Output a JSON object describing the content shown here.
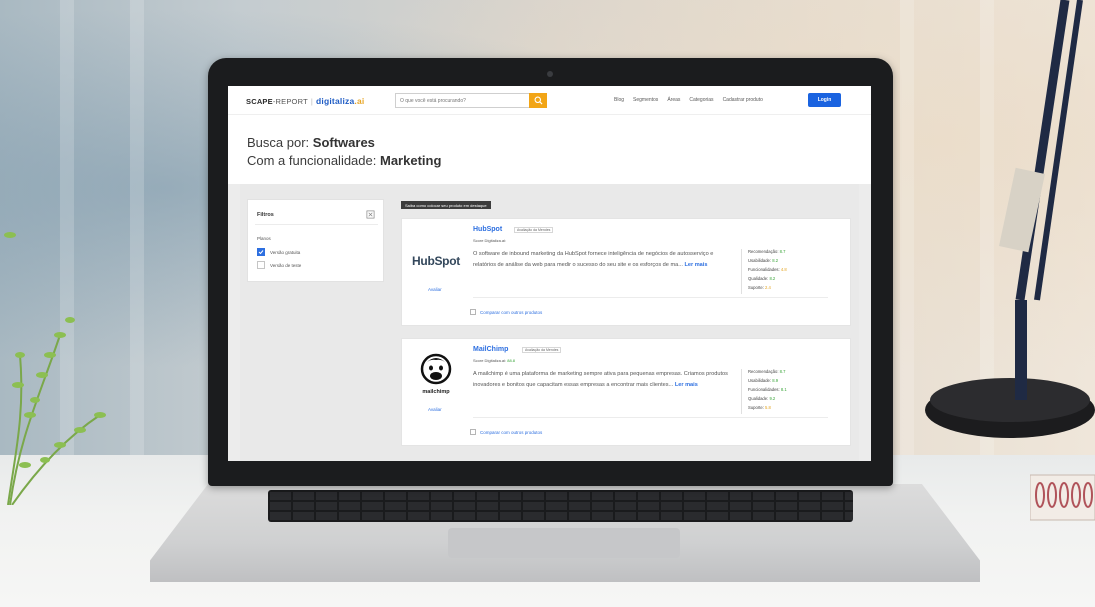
{
  "site": {
    "logo_part1": "SCAPE",
    "logo_part2": "-REPORT",
    "logo_brand": "digitaliza",
    "logo_brand_tld": ".ai"
  },
  "search": {
    "placeholder": "O que você está procurando?"
  },
  "nav": {
    "items": [
      "Blog",
      "Segmentos",
      "Áreas",
      "Categorias",
      "Cadastrar produto"
    ],
    "login_label": "Login"
  },
  "header": {
    "line1_prefix": "Busca por:",
    "line1_value": "Softwares",
    "line2_prefix": "Com a funcionalidade:",
    "line2_value": "Marketing"
  },
  "filters": {
    "title": "Filtros",
    "group_label": "Planos",
    "options": [
      {
        "label": "Versão gratuita",
        "checked": true
      },
      {
        "label": "Versão de teste",
        "checked": false
      }
    ]
  },
  "featured_tag": "Saiba como colocar seu produto em destaque",
  "products": [
    {
      "name": "HubSpot",
      "badge": "Avaliação da Mendes",
      "score_label": "Score Digitaliza.ai:",
      "score_value": "",
      "description": "O software de inbound marketing da HubSpot fornece inteligência de negócios de autosserviço e relatórios de análise da web para medir o sucesso do seu site e os esforços de ma...",
      "read_more": "Ler mais",
      "evaluate": "Avaliar",
      "compare": "Comparar com outros produtos",
      "logo_text": "HubSpot",
      "metrics": [
        {
          "label": "Recomendação:",
          "value": "8.7",
          "color": "green"
        },
        {
          "label": "Usabilidade:",
          "value": "8.2",
          "color": "green"
        },
        {
          "label": "Funcionalidades:",
          "value": "4.8",
          "color": "yellow"
        },
        {
          "label": "Qualidade:",
          "value": "8.2",
          "color": "green"
        },
        {
          "label": "Suporte:",
          "value": "2.4",
          "color": "yellow"
        }
      ]
    },
    {
      "name": "MailChimp",
      "badge": "Avaliação da Mendes",
      "score_label": "Score Digitaliza.ai:",
      "score_value": "88.8",
      "description": "A mailchimp é uma plataforma de marketing sempre ativa para pequenas empresas. Criamos produtos inovadores e bonitos que capacitam essas empresas a encontrar mais clientes...",
      "read_more": "Ler mais",
      "evaluate": "Avaliar",
      "compare": "Comparar com outros produtos",
      "logo_text": "mailchimp",
      "metrics": [
        {
          "label": "Recomendação:",
          "value": "8.7",
          "color": "green"
        },
        {
          "label": "Usabilidade:",
          "value": "8.9",
          "color": "green"
        },
        {
          "label": "Funcionalidades:",
          "value": "8.1",
          "color": "green"
        },
        {
          "label": "Qualidade:",
          "value": "9.2",
          "color": "green"
        },
        {
          "label": "Suporte:",
          "value": "5.8",
          "color": "yellow"
        }
      ]
    }
  ],
  "colors": {
    "accent_blue": "#2d6fe0",
    "search_orange": "#f2a516",
    "score_green": "#3aa53a",
    "score_yellow": "#e3a41f"
  }
}
